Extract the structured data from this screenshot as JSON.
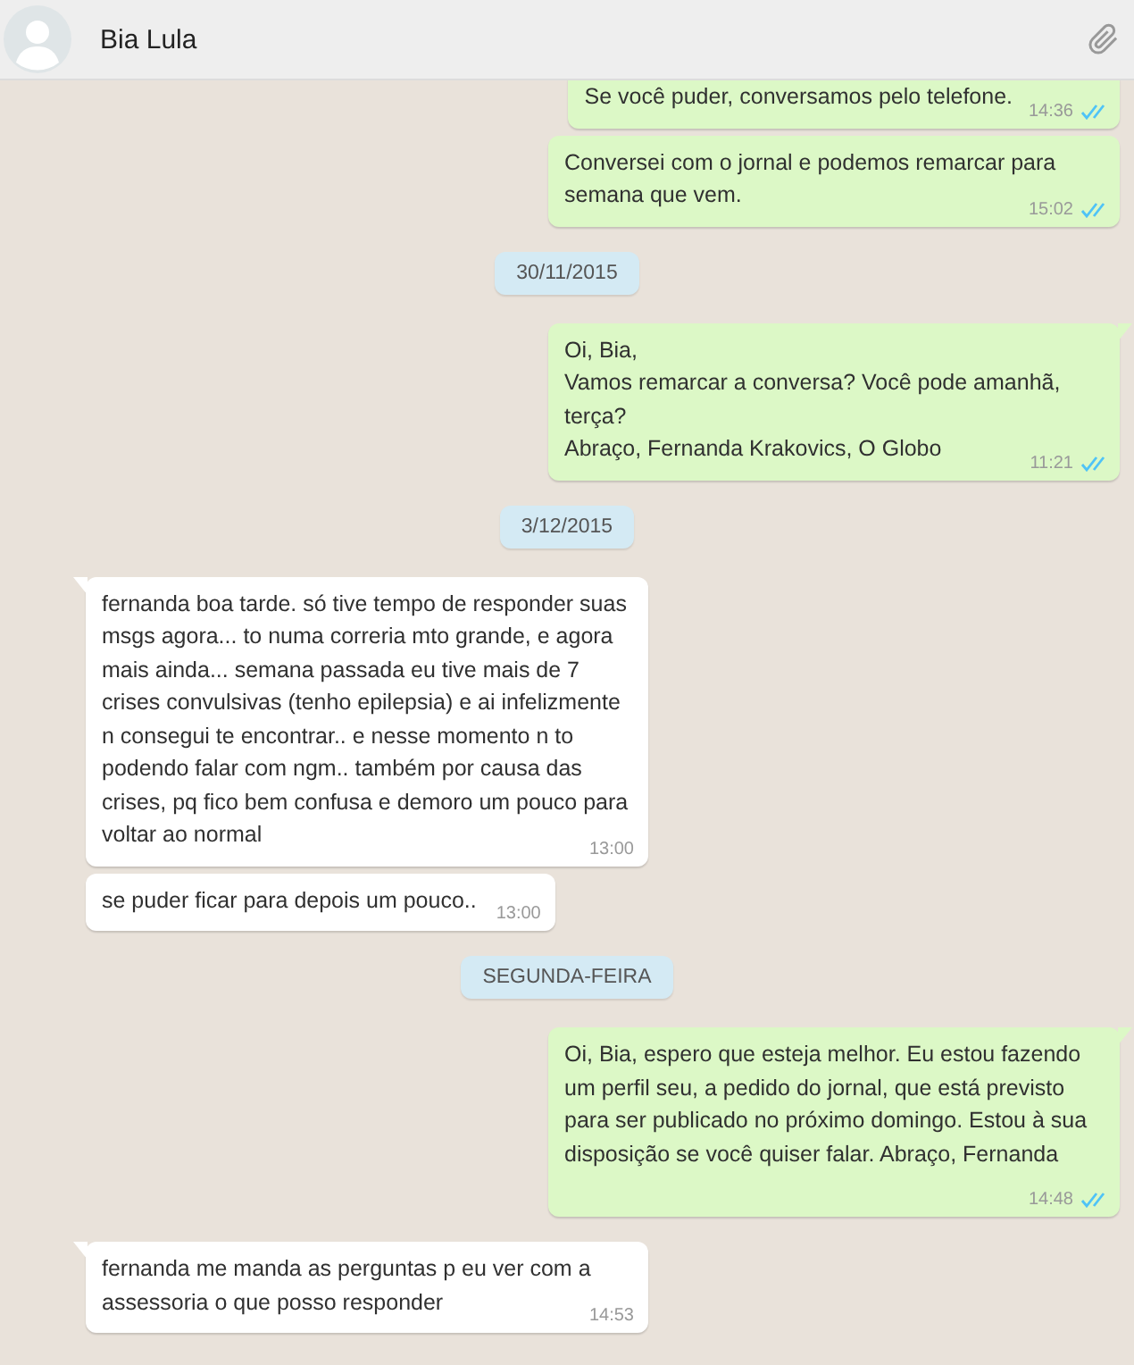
{
  "header": {
    "contact_name": "Bia Lula"
  },
  "messages": [
    {
      "kind": "sent",
      "text": "Se você puder, conversamos pelo telefone.",
      "time": "14:36",
      "read": true
    },
    {
      "kind": "sent",
      "text": "Conversei com o jornal e podemos remarcar para semana que vem.",
      "time": "15:02",
      "read": true
    },
    {
      "kind": "date",
      "text": "30/11/2015"
    },
    {
      "kind": "sent",
      "text": "Oi, Bia,\nVamos remarcar a conversa? Você pode amanhã, terça?\nAbraço, Fernanda Krakovics, O Globo",
      "time": "11:21",
      "read": true,
      "tail": true
    },
    {
      "kind": "date",
      "text": "3/12/2015"
    },
    {
      "kind": "received",
      "text": "fernanda boa tarde. só tive tempo de responder suas msgs agora... to numa correria mto grande, e agora mais ainda... semana passada eu tive mais de 7 crises convulsivas (tenho epilepsia) e ai infelizmente n consegui te encontrar.. e nesse momento n to podendo falar com ngm.. também por causa das crises, pq fico bem confusa e demoro um pouco para voltar ao normal",
      "time": "13:00",
      "tail": true
    },
    {
      "kind": "received",
      "text": "se puder ficar para depois um pouco..",
      "time": "13:00",
      "tail": false
    },
    {
      "kind": "date",
      "text": "SEGUNDA-FEIRA"
    },
    {
      "kind": "sent",
      "text": "Oi, Bia, espero que esteja melhor. Eu estou fazendo um perfil seu, a pedido do jornal, que está previsto para ser publicado no próximo domingo. Estou à sua disposição se você quiser falar. Abraço, Fernanda",
      "time": "14:48",
      "read": true,
      "tail": true
    },
    {
      "kind": "received",
      "text": "fernanda me manda as perguntas p eu ver com a assessoria o que posso responder",
      "time": "14:53",
      "tail": true
    }
  ]
}
